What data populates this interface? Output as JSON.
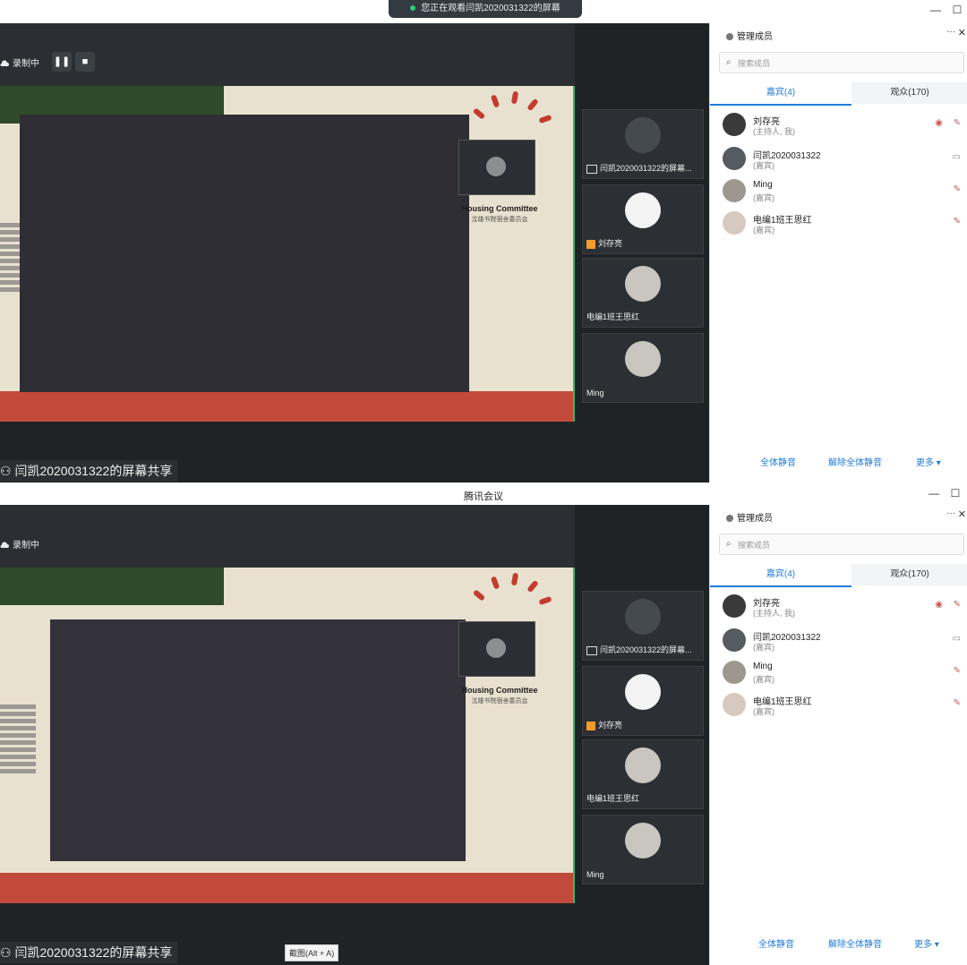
{
  "top": {
    "stream_title": "您正在观看闫凯2020031322的屏幕",
    "record": {
      "label": "录制中",
      "pause_icon": "pause-icon",
      "stop_icon": "stop-icon"
    },
    "share_caption": "闫凯2020031322的屏幕共享",
    "logo": {
      "title": "Housing Committee",
      "subtitle": "沈雄书院宿舍委员会"
    }
  },
  "bottom": {
    "app_title": "腾讯会议",
    "record": {
      "label": "录制中"
    },
    "share_caption": "闫凯2020031322的屏幕共享",
    "screenshot_hint": "截图(Alt + A)",
    "logo": {
      "title": "Housing Committee",
      "subtitle": "沈雄书院宿舍委员会"
    }
  },
  "gallery": [
    {
      "name": "闫凯2020031322的屏幕...",
      "face": "dark"
    },
    {
      "name": "刘存亮",
      "face": "sketch"
    },
    {
      "name": "电编1班王思红",
      "face": "light"
    },
    {
      "name": "Ming",
      "face": "light"
    }
  ],
  "panel": {
    "title": "管理成员",
    "more": "···",
    "search_placeholder": "搜索成员",
    "tab_guests": "嘉宾(4)",
    "tab_audience": "观众(170)",
    "members": [
      {
        "name": "刘存亮",
        "role": "(主持人, 我)"
      },
      {
        "name": "闫凯2020031322",
        "role": "(嘉宾)"
      },
      {
        "name": "Ming",
        "role": "(嘉宾)"
      },
      {
        "name": "电编1班王思红",
        "role": "(嘉宾)"
      }
    ],
    "footer": {
      "mute_all": "全体静音",
      "unmute_all": "解除全体静音",
      "more": "更多"
    }
  },
  "colors": {
    "accent": "#1f7bd8",
    "dark_bg": "#1f2326",
    "share_border": "#39b36b",
    "record_bg": "#2b2f33"
  }
}
